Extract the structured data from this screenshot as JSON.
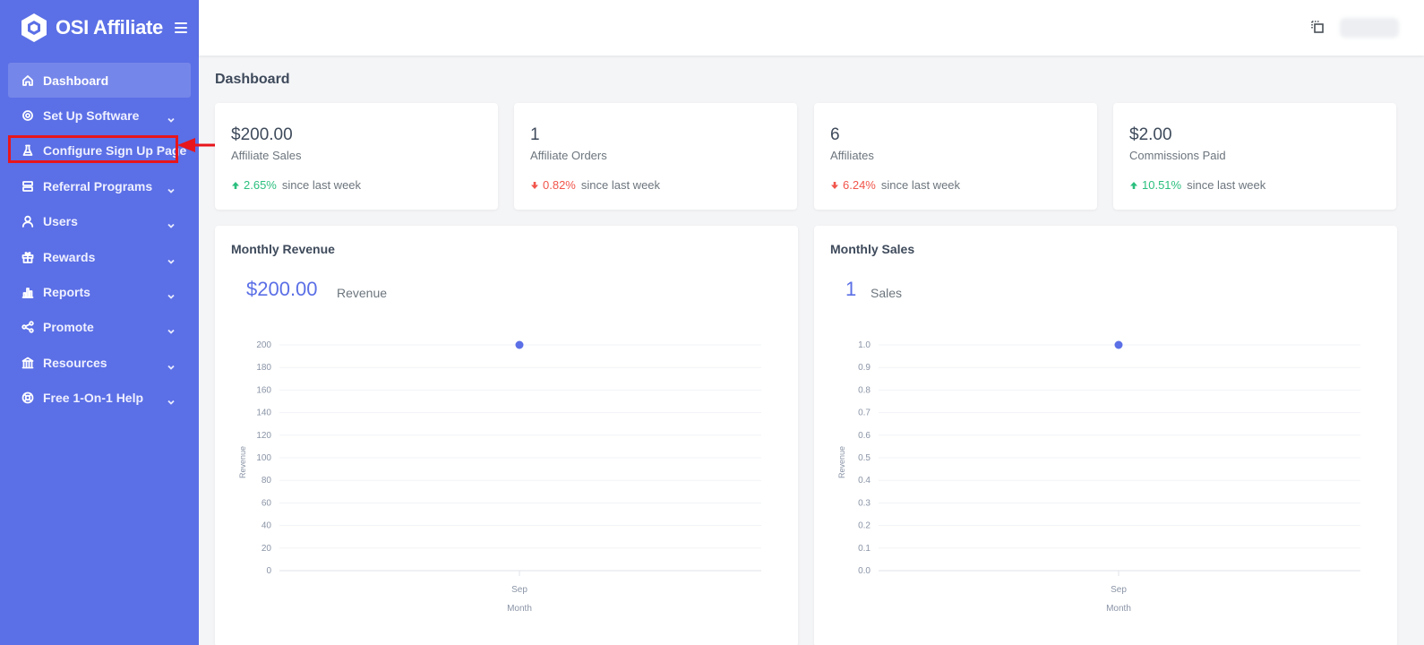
{
  "brand": {
    "name": "OSI Affiliate"
  },
  "sidebar": {
    "items": [
      {
        "label": "Dashboard",
        "icon": "home-icon",
        "active": true,
        "expandable": false
      },
      {
        "label": "Set Up Software",
        "icon": "gear-icon",
        "active": false,
        "expandable": true
      },
      {
        "label": "Configure Sign Up Page",
        "icon": "flask-icon",
        "active": false,
        "expandable": false
      },
      {
        "label": "Referral Programs",
        "icon": "layers-icon",
        "active": false,
        "expandable": true
      },
      {
        "label": "Users",
        "icon": "user-icon",
        "active": false,
        "expandable": true
      },
      {
        "label": "Rewards",
        "icon": "gift-icon",
        "active": false,
        "expandable": true
      },
      {
        "label": "Reports",
        "icon": "bar-chart-icon",
        "active": false,
        "expandable": true
      },
      {
        "label": "Promote",
        "icon": "share-icon",
        "active": false,
        "expandable": true
      },
      {
        "label": "Resources",
        "icon": "bank-icon",
        "active": false,
        "expandable": true
      },
      {
        "label": "Free 1-On-1 Help",
        "icon": "lifebuoy-icon",
        "active": false,
        "expandable": true
      }
    ]
  },
  "page": {
    "title": "Dashboard"
  },
  "stats": [
    {
      "value": "$200.00",
      "label": "Affiliate Sales",
      "delta": "2.65%",
      "direction": "up",
      "suffix": "since last week"
    },
    {
      "value": "1",
      "label": "Affiliate Orders",
      "delta": "0.82%",
      "direction": "down",
      "suffix": "since last week"
    },
    {
      "value": "6",
      "label": "Affiliates",
      "delta": "6.24%",
      "direction": "down",
      "suffix": "since last week"
    },
    {
      "value": "$2.00",
      "label": "Commissions Paid",
      "delta": "10.51%",
      "direction": "up",
      "suffix": "since last week"
    }
  ],
  "charts": {
    "revenue": {
      "title": "Monthly Revenue",
      "big_value": "$200.00",
      "big_label": "Revenue"
    },
    "sales": {
      "title": "Monthly Sales",
      "big_value": "1",
      "big_label": "Sales"
    }
  },
  "colors": {
    "sidebar": "#5b6fe6",
    "accent": "#5b6fe6",
    "up": "#2bbf7e",
    "down": "#f1554b",
    "highlight": "#e8151b"
  },
  "chart_data": [
    {
      "type": "scatter",
      "title": "",
      "categories": [
        "Sep"
      ],
      "values": [
        200
      ],
      "xlabel": "Month",
      "ylabel": "Revenue",
      "ylim": [
        0,
        200
      ],
      "yticks": [
        "0",
        "20",
        "40",
        "60",
        "80",
        "100",
        "120",
        "140",
        "160",
        "180",
        "200"
      ],
      "grid": true
    },
    {
      "type": "scatter",
      "title": "",
      "categories": [
        "Sep"
      ],
      "values": [
        1.0
      ],
      "xlabel": "Month",
      "ylabel": "Revenue",
      "ylim": [
        0,
        1
      ],
      "yticks": [
        "0.0",
        "0.1",
        "0.2",
        "0.3",
        "0.4",
        "0.5",
        "0.6",
        "0.7",
        "0.8",
        "0.9",
        "1.0"
      ],
      "grid": true
    }
  ]
}
